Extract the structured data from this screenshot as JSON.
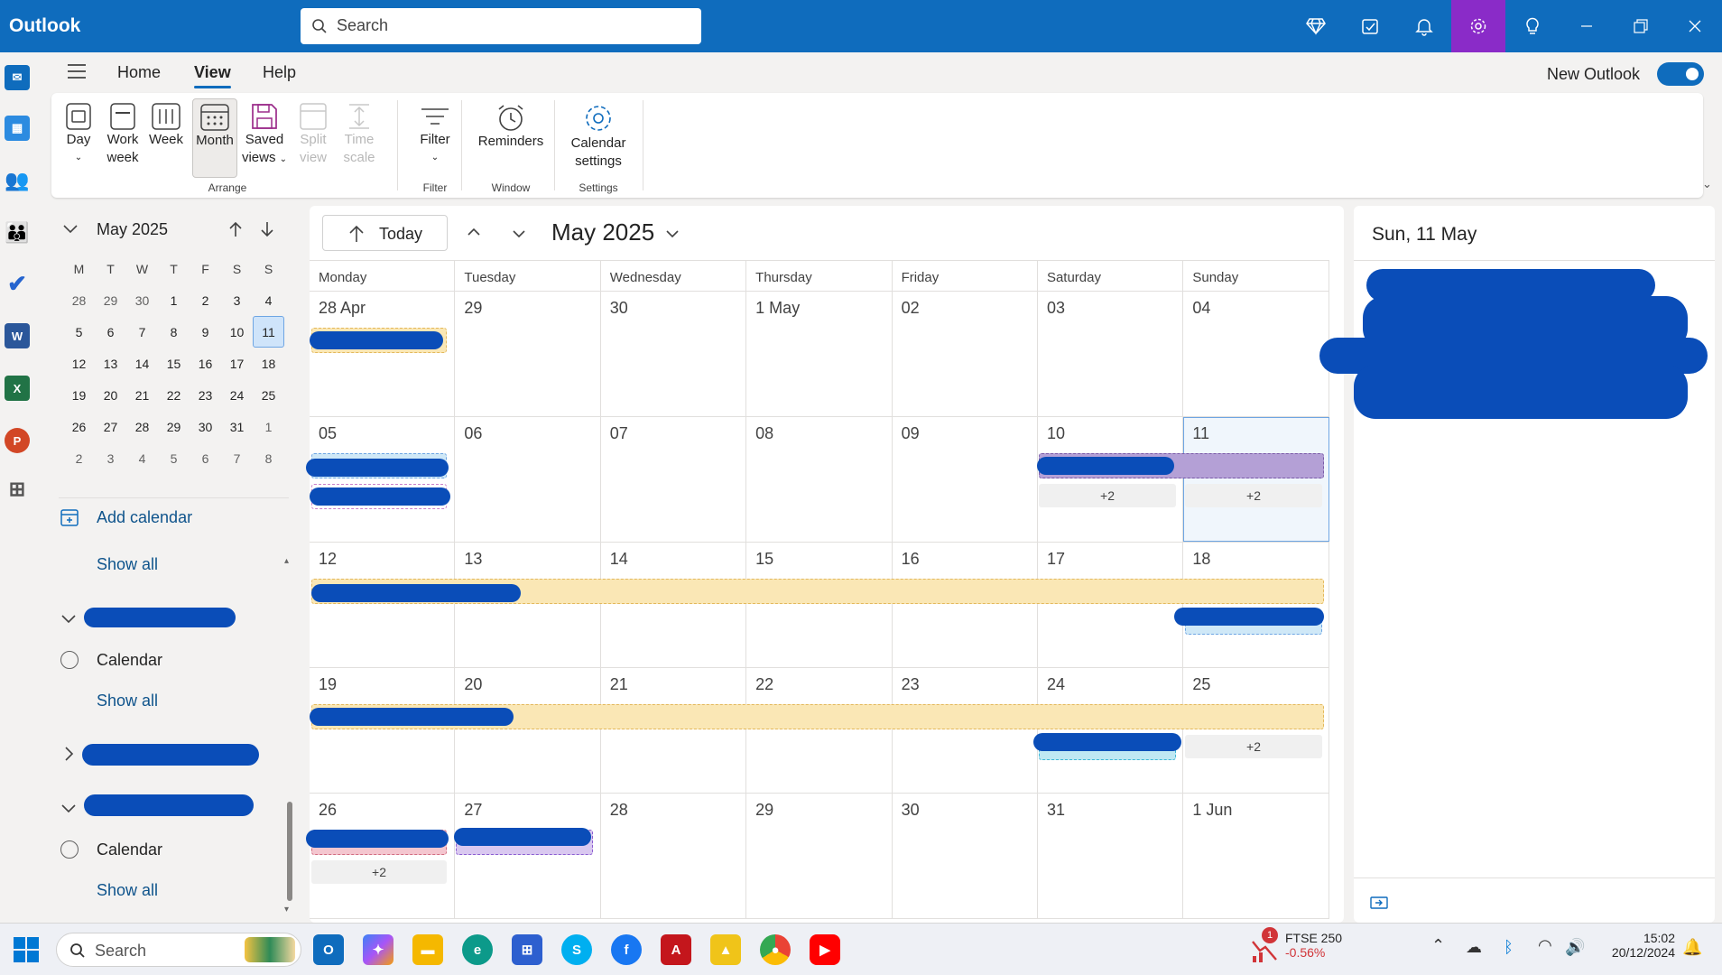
{
  "titlebar": {
    "app_name": "Outlook",
    "search_placeholder": "Search"
  },
  "menu": {
    "tabs": [
      "Home",
      "View",
      "Help"
    ],
    "selected_tab": "View",
    "new_outlook_label": "New Outlook",
    "new_outlook_on": true
  },
  "ribbon": {
    "buttons": {
      "day": "Day",
      "work_week_1": "Work",
      "work_week_2": "week",
      "week": "Week",
      "month": "Month",
      "saved_views_1": "Saved",
      "saved_views_2": "views",
      "split_view_1": "Split",
      "split_view_2": "view",
      "time_scale_1": "Time",
      "time_scale_2": "scale",
      "filter": "Filter",
      "reminders": "Reminders",
      "calendar_settings_1": "Calendar",
      "calendar_settings_2": "settings"
    },
    "groups": {
      "arrange": "Arrange",
      "filter": "Filter",
      "window": "Window",
      "settings": "Settings"
    }
  },
  "mini_calendar": {
    "title": "May 2025",
    "dow": [
      "M",
      "T",
      "W",
      "T",
      "F",
      "S",
      "S"
    ],
    "weeks": [
      [
        "28",
        "29",
        "30",
        "1",
        "2",
        "3",
        "4"
      ],
      [
        "5",
        "6",
        "7",
        "8",
        "9",
        "10",
        "11"
      ],
      [
        "12",
        "13",
        "14",
        "15",
        "16",
        "17",
        "18"
      ],
      [
        "19",
        "20",
        "21",
        "22",
        "23",
        "24",
        "25"
      ],
      [
        "26",
        "27",
        "28",
        "29",
        "30",
        "31",
        "1"
      ],
      [
        "2",
        "3",
        "4",
        "5",
        "6",
        "7",
        "8"
      ]
    ]
  },
  "sidebar": {
    "add_calendar": "Add calendar",
    "show_all_1": "Show all",
    "calendar_1": "Calendar",
    "show_all_2": "Show all",
    "calendar_2": "Calendar",
    "show_all_3": "Show all"
  },
  "calendar": {
    "today_label": "Today",
    "title": "May 2025",
    "days_of_week": [
      "Monday",
      "Tuesday",
      "Wednesday",
      "Thursday",
      "Friday",
      "Saturday",
      "Sunday"
    ],
    "weeks": [
      [
        "28 Apr",
        "29",
        "30",
        "1 May",
        "02",
        "03",
        "04"
      ],
      [
        "05",
        "06",
        "07",
        "08",
        "09",
        "10",
        "11"
      ],
      [
        "12",
        "13",
        "14",
        "15",
        "16",
        "17",
        "18"
      ],
      [
        "19",
        "20",
        "21",
        "22",
        "23",
        "24",
        "25"
      ],
      [
        "26",
        "27",
        "28",
        "29",
        "30",
        "31",
        "1 Jun"
      ]
    ],
    "more_label": "+2"
  },
  "right_pane": {
    "title": "Sun, 11 May"
  },
  "taskbar": {
    "search_placeholder": "Search",
    "stock_name": "FTSE 250",
    "stock_change": "-0.56%",
    "stock_badge": "1",
    "time": "15:02",
    "date": "20/12/2024"
  },
  "colors": {
    "brand": "#0f6cbd",
    "settings_active": "#8a2bc8",
    "event_yellow": "#fae7b5",
    "event_purple": "#b4a0d6",
    "redaction": "#0a4db8"
  }
}
